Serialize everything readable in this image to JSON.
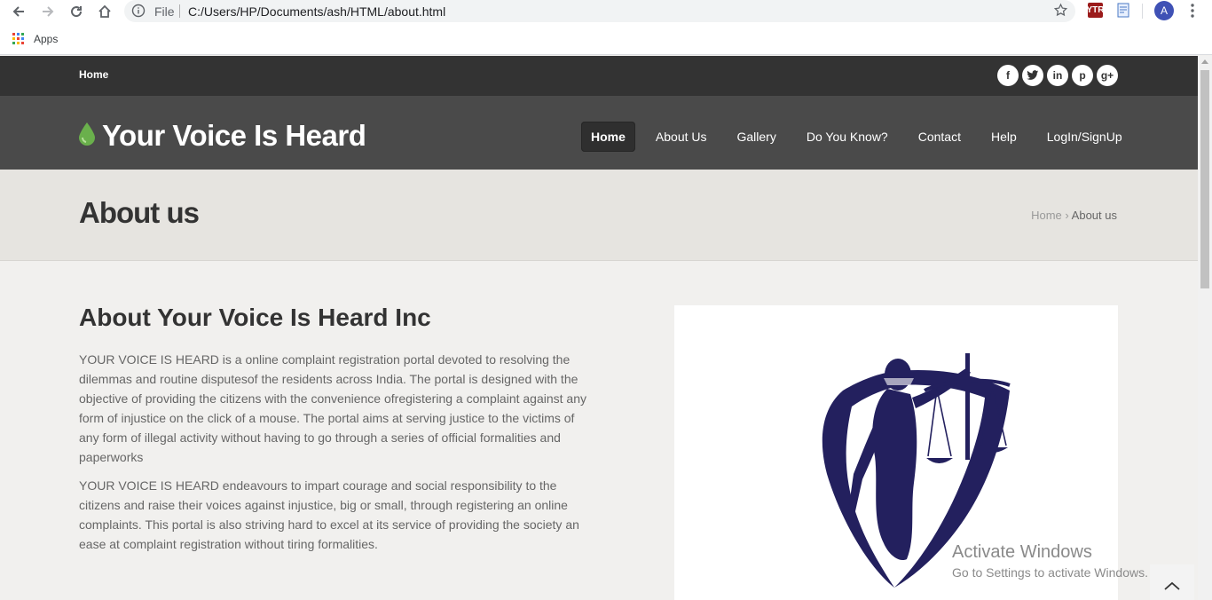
{
  "browser": {
    "file_label": "File",
    "url": "C:/Users/HP/Documents/ash/HTML/about.html",
    "extension_label": "YTR",
    "avatar_letter": "A",
    "bookmarks": {
      "apps_label": "Apps"
    }
  },
  "topbar": {
    "home_label": "Home",
    "socials": [
      "f",
      "t",
      "in",
      "p",
      "g+"
    ]
  },
  "header": {
    "logo_text": "Your Voice Is Heard",
    "nav": [
      "Home",
      "About Us",
      "Gallery",
      "Do You Know?",
      "Contact",
      "Help",
      "LogIn/SignUp"
    ],
    "active_nav": "Home"
  },
  "title_bar": {
    "title": "About us",
    "breadcrumb_home": "Home",
    "breadcrumb_sep": "›",
    "breadcrumb_current": "About us"
  },
  "content": {
    "heading": "About Your Voice Is Heard Inc",
    "paragraph_1": "YOUR VOICE IS HEARD is a online complaint registration portal devoted to resolving the dilemmas and routine disputesof the residents across India. The portal is designed with the objective of providing the citizens with the convenience ofregistering a complaint against any form of injustice on the click of a mouse. The portal aims at serving justice to the victims of any form of illegal activity without having to go through a series of official formalities and paperworks",
    "paragraph_2": "YOUR VOICE IS HEARD endeavours to impart courage and social responsibility to the citizens and raise their voices against injustice, big or small, through registering an online complaints. This portal is also striving hard to excel at its service of providing the society an ease at complaint registration without tiring formalities."
  },
  "overlay": {
    "activate_title": "Activate Windows",
    "activate_sub": "Go to Settings to activate Windows."
  },
  "colors": {
    "topbar": "#333333",
    "header": "#4a4a4a",
    "logo_drop": "#6ab04c",
    "justice_logo": "#23205e"
  }
}
